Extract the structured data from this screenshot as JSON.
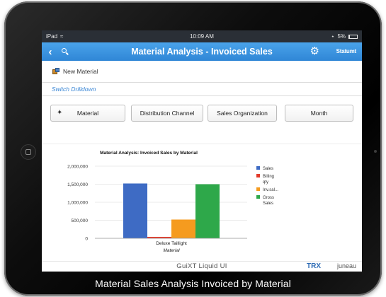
{
  "statusbar": {
    "device": "iPad",
    "wifi_icon": "wifi-icon",
    "time": "10:09 AM",
    "battery": "5%"
  },
  "navbar": {
    "back_icon": "back-chevron-icon",
    "search_icon": "search-icon",
    "title": "Material Analysis - Invoiced Sales",
    "gear_icon": "gear-icon",
    "status_label": "Statumt"
  },
  "toolbar": {
    "new_material_label": "New Material"
  },
  "drilldown": {
    "link_label": "Switch Drilldown",
    "buttons": [
      "Material",
      "Distribution Channel",
      "Sales Organization",
      "Month"
    ]
  },
  "chart_data": {
    "type": "bar",
    "title": "Material Analysis: Invoiced Sales by Material",
    "categories": [
      "Deluxe Taillight"
    ],
    "xlabel": "Material",
    "ylabel": "",
    "ylim": [
      0,
      2000000
    ],
    "yticks": [
      "2,000,000",
      "1,500,000",
      "1,000,000",
      "500,000",
      "0"
    ],
    "grid": true,
    "legend_position": "right",
    "series": [
      {
        "name": "Sales",
        "color": "#3e6bc4",
        "values": [
          1520000
        ]
      },
      {
        "name": "Billing qty",
        "color": "#e23a2a",
        "values": [
          40000
        ]
      },
      {
        "name": "Inv.sal...",
        "color": "#f59b1f",
        "values": [
          520000
        ]
      },
      {
        "name": "Gross Sales",
        "color": "#2ea84a",
        "values": [
          1500000
        ]
      }
    ]
  },
  "footer": {
    "center": "GuiXT Liquid UI",
    "brand": "TRX",
    "location": "juneau"
  },
  "caption": "Material Sales Analysis Invoiced by Material"
}
